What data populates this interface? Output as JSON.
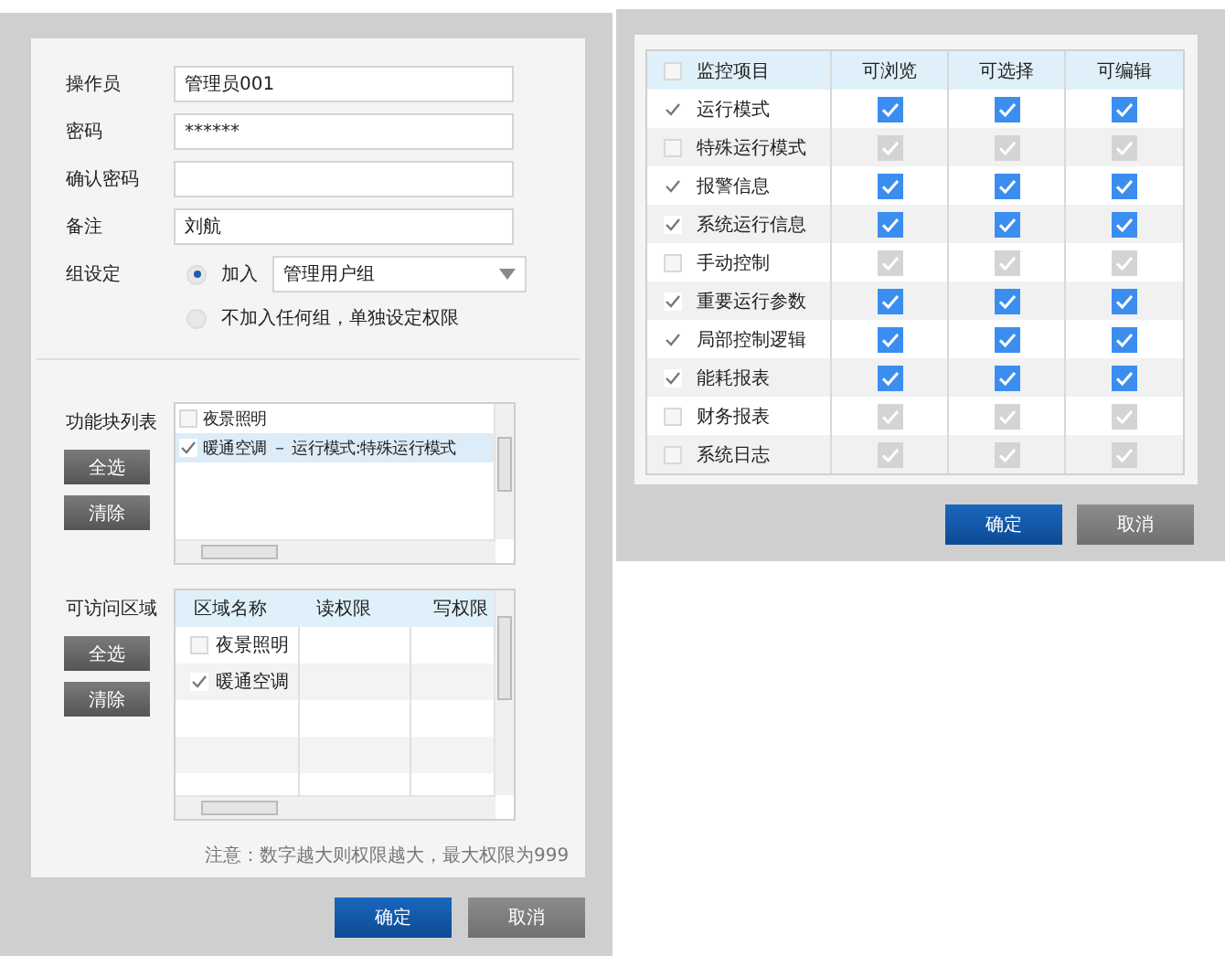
{
  "user_form": {
    "fields": [
      {
        "label": "操作员",
        "value": "管理员001"
      },
      {
        "label": "密码",
        "value": "******"
      },
      {
        "label": "确认密码"
      },
      {
        "label": "备注",
        "value": "刘航"
      }
    ],
    "group": {
      "label": "组设定",
      "options": [
        {
          "label": "加入",
          "selected": true
        },
        {
          "label": "不加入任何组，单独设定权限",
          "selected": false
        }
      ],
      "dropdown_value": "管理用户组"
    },
    "function_list": {
      "label": "功能块列表",
      "buttons": [
        "全选",
        "清除"
      ],
      "items": [
        {
          "text": "夜景照明",
          "checked": false,
          "selected": false
        },
        {
          "text": "暖通空调 － 运行模式:特殊运行模式",
          "checked": true,
          "selected": true
        }
      ]
    },
    "zones": {
      "label": "可访问区域",
      "buttons": [
        "全选",
        "清除"
      ],
      "columns": [
        "区域名称",
        "读权限",
        "写权限"
      ],
      "rows": [
        {
          "name": "夜景照明",
          "checked": false
        },
        {
          "name": "暖通空调",
          "checked": true
        }
      ]
    },
    "note": "注意：数字越大则权限越大，最大权限为999",
    "buttons": [
      "确定",
      "取消"
    ]
  },
  "permissions": {
    "columns": [
      "监控项目",
      "可浏览",
      "可选择",
      "可编辑"
    ],
    "header_checked": false,
    "rows": [
      {
        "name": "运行模式",
        "checked": true,
        "perms": [
          true,
          true,
          true
        ]
      },
      {
        "name": "特殊运行模式",
        "checked": false,
        "perms": [
          true,
          true,
          true
        ]
      },
      {
        "name": "报警信息",
        "checked": true,
        "perms": [
          true,
          true,
          true
        ]
      },
      {
        "name": "系统运行信息",
        "checked": true,
        "perms": [
          true,
          true,
          true
        ]
      },
      {
        "name": "手动控制",
        "checked": false,
        "perms": [
          true,
          true,
          true
        ]
      },
      {
        "name": "重要运行参数",
        "checked": true,
        "perms": [
          true,
          true,
          true
        ]
      },
      {
        "name": "局部控制逻辑",
        "checked": true,
        "perms": [
          true,
          true,
          true
        ]
      },
      {
        "name": "能耗报表",
        "checked": true,
        "perms": [
          true,
          true,
          true
        ]
      },
      {
        "name": "财务报表",
        "checked": false,
        "perms": [
          true,
          true,
          true
        ]
      },
      {
        "name": "系统日志",
        "checked": false,
        "perms": [
          true,
          true,
          true
        ]
      }
    ],
    "buttons": [
      "确定",
      "取消"
    ]
  }
}
